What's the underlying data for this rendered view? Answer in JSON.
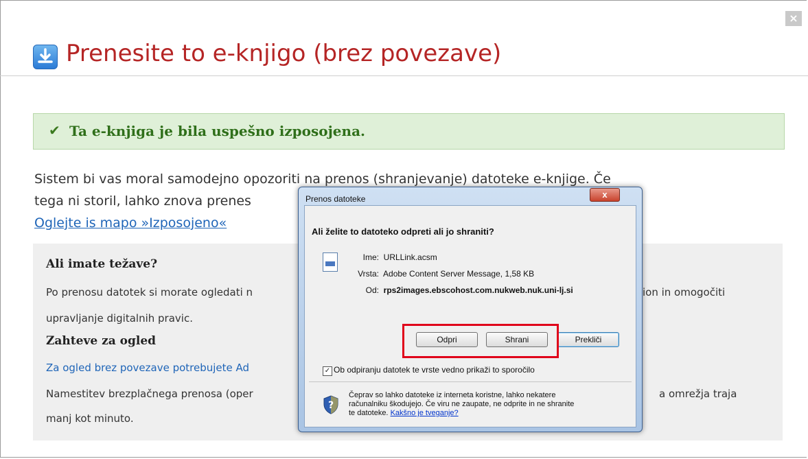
{
  "modal": {
    "title": "Prenesite to e-knjigo (brez povezave)",
    "close_glyph": "×",
    "success_message": "Ta e-knjiga je bila uspešno izposojena.",
    "intro_line1": "Sistem bi vas moral samodejno opozoriti na prenos (shranjevanje) datoteke e-knjige. Če",
    "intro_line2": "tega ni storil, lahko znova prenes",
    "intro_link": "Oglejte is mapo »Izposojeno«",
    "help": {
      "heading1": "Ali imate težave?",
      "line1_left": "Po prenosu datotek si morate ogledati n",
      "line1_right": "ion in omogočiti",
      "line2": "upravljanje digitalnih pravic.",
      "heading2": "Zahteve za ogled",
      "line3_link": "Za ogled brez povezave potrebujete Ad",
      "line4_left": "Namestitev brezplačnega prenosa (oper",
      "line4_right": "a omrežja traja",
      "line5": "manj kot minuto."
    }
  },
  "dialog": {
    "title": "Prenos datoteke",
    "close_glyph": "x",
    "question": "Ali želite to datoteko odpreti ali jo shraniti?",
    "fields": [
      {
        "label": "Ime:",
        "value": "URLLink.acsm",
        "bold": false
      },
      {
        "label": "Vrsta:",
        "value": "Adobe Content Server Message, 1,58 KB",
        "bold": false
      },
      {
        "label": "Od:",
        "value": "rps2images.ebscohost.com.nukweb.nuk.uni-lj.si",
        "bold": true
      }
    ],
    "buttons": {
      "open": "Odpri",
      "save": "Shrani",
      "cancel": "Prekliči"
    },
    "checkbox_label": "Ob odpiranju datotek te vrste vedno prikaži to sporočilo",
    "checkbox_checked": true,
    "warning_line1": "Čeprav so lahko datoteke iz interneta koristne, lahko nekatere",
    "warning_line2": "računalniku škodujejo. Če viru ne zaupate, ne odprite in ne shranite",
    "warning_line3": "te datoteke.",
    "warning_link": "Kakšno je tveganje?"
  },
  "colors": {
    "title": "#b52525",
    "success_bg": "#dff0d8",
    "link": "#1f65b8",
    "highlight": "#e0001a"
  }
}
